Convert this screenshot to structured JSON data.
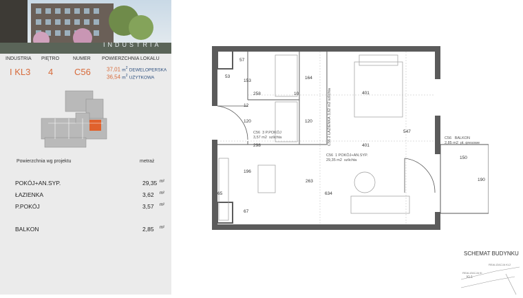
{
  "brand": "INDUSTRIA",
  "header": {
    "labels": [
      "INDUSTRIA",
      "PIĘTRO",
      "NUMER",
      "POWIERZCHNIA LOKALU"
    ],
    "industria": "I KL3",
    "pietro": "4",
    "numer": "C56",
    "area_dev": "37,01",
    "area_dev_label": "DEWELOPERSKA",
    "area_use": "36,54",
    "area_use_label": "UŻYTKOWA",
    "unit": "m"
  },
  "rooms_title": "Powierzchnia wg projektu",
  "rooms_unit_title": "metraż",
  "rooms": [
    {
      "name": "POKÓJ+AN.SYP.",
      "value": "29,35",
      "unit": "m²"
    },
    {
      "name": "ŁAZIENKA",
      "value": "3,62",
      "unit": "m²"
    },
    {
      "name": "P.POKÓJ",
      "value": "3,57",
      "unit": "m²"
    },
    {
      "name": "BALKON",
      "value": "2,85",
      "unit": "m²"
    }
  ],
  "plan": {
    "dims": [
      "57",
      "53",
      "153",
      "258",
      "10",
      "164",
      "401",
      "120",
      "120",
      "547",
      "298",
      "401",
      "196",
      "263",
      "634",
      "65",
      "67",
      "150",
      "190",
      "12"
    ],
    "tags": {
      "c56": "C56",
      "ppokoj": "3 P.POKÓJ",
      "ppokoj_area": "3,57 m2",
      "ppokoj_floor": "szlichta",
      "lazienka": "2 ŁAZIENKA",
      "lazienka_area": "3,62 m2",
      "lazienka_floor": "szlichta",
      "pokoj": "1 POKÓJ+AN.SYP.",
      "pokoj_area": "29,35 m2",
      "pokoj_floor": "szlichta",
      "balkon": "BALKON",
      "balkon_area": "2,85 m2",
      "balkon_floor": "pł. gresowe"
    }
  },
  "schema_title": "SCHEMAT BUDYNKU",
  "schema_labels": [
    "REALIZACJA KL2",
    "REALIZACJA III",
    "KL1"
  ]
}
